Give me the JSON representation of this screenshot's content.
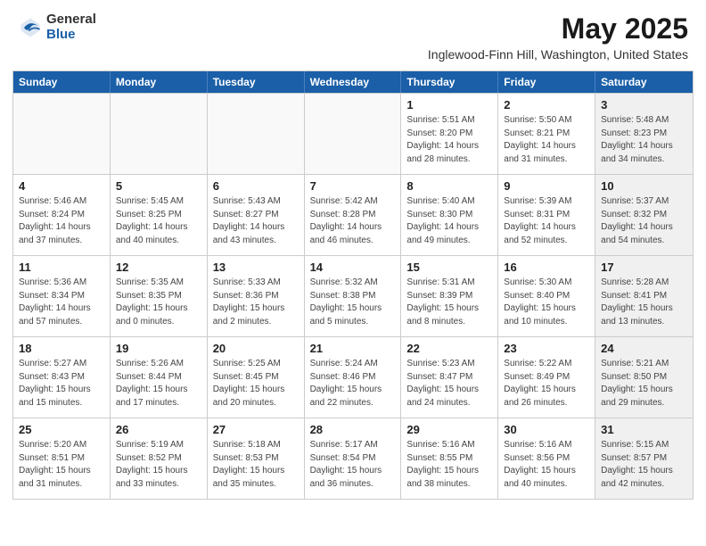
{
  "header": {
    "logo_general": "General",
    "logo_blue": "Blue",
    "main_title": "May 2025",
    "subtitle": "Inglewood-Finn Hill, Washington, United States"
  },
  "calendar": {
    "headers": [
      "Sunday",
      "Monday",
      "Tuesday",
      "Wednesday",
      "Thursday",
      "Friday",
      "Saturday"
    ],
    "rows": [
      [
        {
          "day": "",
          "detail": "",
          "empty": true
        },
        {
          "day": "",
          "detail": "",
          "empty": true
        },
        {
          "day": "",
          "detail": "",
          "empty": true
        },
        {
          "day": "",
          "detail": "",
          "empty": true
        },
        {
          "day": "1",
          "detail": "Sunrise: 5:51 AM\nSunset: 8:20 PM\nDaylight: 14 hours\nand 28 minutes."
        },
        {
          "day": "2",
          "detail": "Sunrise: 5:50 AM\nSunset: 8:21 PM\nDaylight: 14 hours\nand 31 minutes."
        },
        {
          "day": "3",
          "detail": "Sunrise: 5:48 AM\nSunset: 8:23 PM\nDaylight: 14 hours\nand 34 minutes.",
          "shaded": true
        }
      ],
      [
        {
          "day": "4",
          "detail": "Sunrise: 5:46 AM\nSunset: 8:24 PM\nDaylight: 14 hours\nand 37 minutes."
        },
        {
          "day": "5",
          "detail": "Sunrise: 5:45 AM\nSunset: 8:25 PM\nDaylight: 14 hours\nand 40 minutes."
        },
        {
          "day": "6",
          "detail": "Sunrise: 5:43 AM\nSunset: 8:27 PM\nDaylight: 14 hours\nand 43 minutes."
        },
        {
          "day": "7",
          "detail": "Sunrise: 5:42 AM\nSunset: 8:28 PM\nDaylight: 14 hours\nand 46 minutes."
        },
        {
          "day": "8",
          "detail": "Sunrise: 5:40 AM\nSunset: 8:30 PM\nDaylight: 14 hours\nand 49 minutes."
        },
        {
          "day": "9",
          "detail": "Sunrise: 5:39 AM\nSunset: 8:31 PM\nDaylight: 14 hours\nand 52 minutes."
        },
        {
          "day": "10",
          "detail": "Sunrise: 5:37 AM\nSunset: 8:32 PM\nDaylight: 14 hours\nand 54 minutes.",
          "shaded": true
        }
      ],
      [
        {
          "day": "11",
          "detail": "Sunrise: 5:36 AM\nSunset: 8:34 PM\nDaylight: 14 hours\nand 57 minutes."
        },
        {
          "day": "12",
          "detail": "Sunrise: 5:35 AM\nSunset: 8:35 PM\nDaylight: 15 hours\nand 0 minutes."
        },
        {
          "day": "13",
          "detail": "Sunrise: 5:33 AM\nSunset: 8:36 PM\nDaylight: 15 hours\nand 2 minutes."
        },
        {
          "day": "14",
          "detail": "Sunrise: 5:32 AM\nSunset: 8:38 PM\nDaylight: 15 hours\nand 5 minutes."
        },
        {
          "day": "15",
          "detail": "Sunrise: 5:31 AM\nSunset: 8:39 PM\nDaylight: 15 hours\nand 8 minutes."
        },
        {
          "day": "16",
          "detail": "Sunrise: 5:30 AM\nSunset: 8:40 PM\nDaylight: 15 hours\nand 10 minutes."
        },
        {
          "day": "17",
          "detail": "Sunrise: 5:28 AM\nSunset: 8:41 PM\nDaylight: 15 hours\nand 13 minutes.",
          "shaded": true
        }
      ],
      [
        {
          "day": "18",
          "detail": "Sunrise: 5:27 AM\nSunset: 8:43 PM\nDaylight: 15 hours\nand 15 minutes."
        },
        {
          "day": "19",
          "detail": "Sunrise: 5:26 AM\nSunset: 8:44 PM\nDaylight: 15 hours\nand 17 minutes."
        },
        {
          "day": "20",
          "detail": "Sunrise: 5:25 AM\nSunset: 8:45 PM\nDaylight: 15 hours\nand 20 minutes."
        },
        {
          "day": "21",
          "detail": "Sunrise: 5:24 AM\nSunset: 8:46 PM\nDaylight: 15 hours\nand 22 minutes."
        },
        {
          "day": "22",
          "detail": "Sunrise: 5:23 AM\nSunset: 8:47 PM\nDaylight: 15 hours\nand 24 minutes."
        },
        {
          "day": "23",
          "detail": "Sunrise: 5:22 AM\nSunset: 8:49 PM\nDaylight: 15 hours\nand 26 minutes."
        },
        {
          "day": "24",
          "detail": "Sunrise: 5:21 AM\nSunset: 8:50 PM\nDaylight: 15 hours\nand 29 minutes.",
          "shaded": true
        }
      ],
      [
        {
          "day": "25",
          "detail": "Sunrise: 5:20 AM\nSunset: 8:51 PM\nDaylight: 15 hours\nand 31 minutes."
        },
        {
          "day": "26",
          "detail": "Sunrise: 5:19 AM\nSunset: 8:52 PM\nDaylight: 15 hours\nand 33 minutes."
        },
        {
          "day": "27",
          "detail": "Sunrise: 5:18 AM\nSunset: 8:53 PM\nDaylight: 15 hours\nand 35 minutes."
        },
        {
          "day": "28",
          "detail": "Sunrise: 5:17 AM\nSunset: 8:54 PM\nDaylight: 15 hours\nand 36 minutes."
        },
        {
          "day": "29",
          "detail": "Sunrise: 5:16 AM\nSunset: 8:55 PM\nDaylight: 15 hours\nand 38 minutes."
        },
        {
          "day": "30",
          "detail": "Sunrise: 5:16 AM\nSunset: 8:56 PM\nDaylight: 15 hours\nand 40 minutes."
        },
        {
          "day": "31",
          "detail": "Sunrise: 5:15 AM\nSunset: 8:57 PM\nDaylight: 15 hours\nand 42 minutes.",
          "shaded": true
        }
      ]
    ]
  }
}
